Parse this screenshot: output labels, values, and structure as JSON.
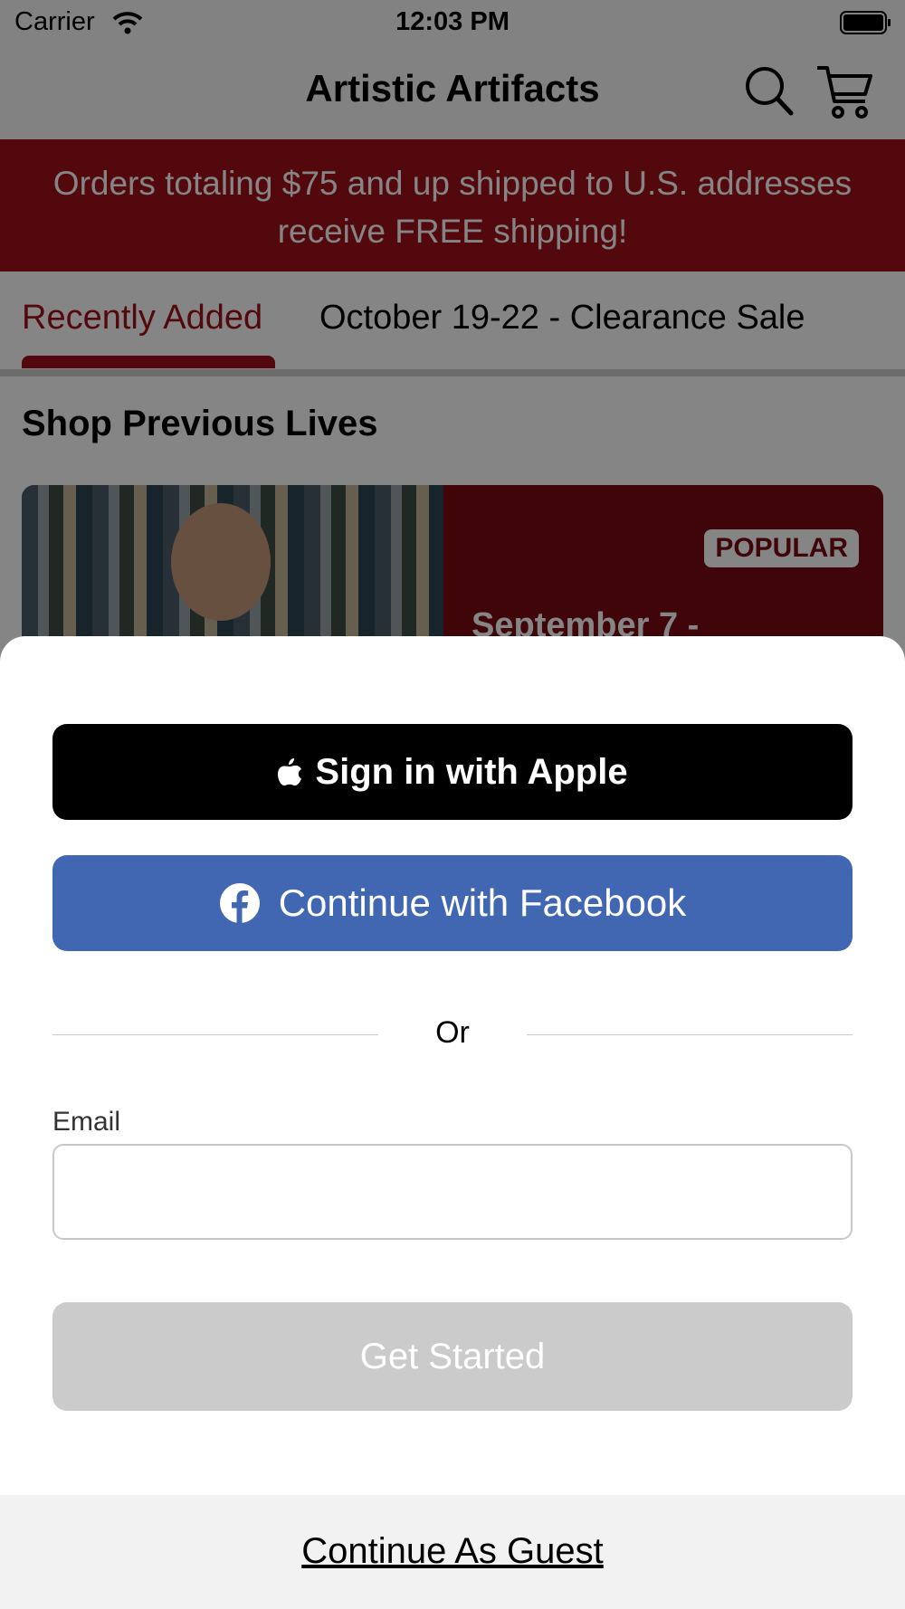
{
  "status_bar": {
    "carrier": "Carrier",
    "time": "12:03 PM"
  },
  "header": {
    "title": "Artistic Artifacts"
  },
  "banner": {
    "line1": "Orders totaling $75 and up shipped to U.S. addresses",
    "line2": "receive FREE shipping!"
  },
  "tabs": [
    {
      "label": "Recently Added",
      "active": true
    },
    {
      "label": "October 19-22 -  Clearance Sale",
      "active": false
    }
  ],
  "section": {
    "title": "Shop Previous Lives"
  },
  "live_card": {
    "badge": "POPULAR",
    "date": "September 7 -"
  },
  "sheet": {
    "apple_button": "Sign in with Apple",
    "facebook_button": "Continue with Facebook",
    "divider_text": "Or",
    "email_label": "Email",
    "email_value": "",
    "email_placeholder": "",
    "get_started_button": "Get Started",
    "guest_link": "Continue As Guest"
  },
  "colors": {
    "brand_red": "#a0101a",
    "facebook_blue": "#4267b2",
    "disabled_gray": "#cbcbcb"
  }
}
